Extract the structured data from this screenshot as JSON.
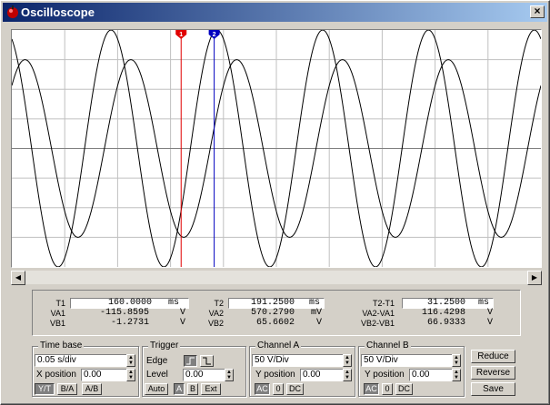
{
  "window": {
    "title": "Oscilloscope",
    "close_label": "×"
  },
  "chart_data": {
    "type": "line",
    "xlim": [
      0,
      0.5
    ],
    "ylim": [
      -200,
      200
    ],
    "grid": true,
    "series": [
      {
        "amplitude": 200,
        "phase_deg": 112.5,
        "freq_hz": 10
      },
      {
        "amplitude": 150,
        "phase_deg": 45,
        "freq_hz": 10
      }
    ],
    "cursors": [
      {
        "label": "1",
        "t": 0.16,
        "color": "#e00000"
      },
      {
        "label": "2",
        "t": 0.19125,
        "color": "#0000c0"
      }
    ]
  },
  "readout": {
    "t1_label": "T1",
    "t1": "160.0000",
    "t1_unit": "ms",
    "va1_label": "VA1",
    "va1": "-115.8595",
    "va1_unit": "V",
    "vb1_label": "VB1",
    "vb1": "-1.2731",
    "vb1_unit": "V",
    "t2_label": "T2",
    "t2": "191.2500",
    "t2_unit": "ms",
    "va2_label": "VA2",
    "va2": "570.2790",
    "va2_unit": "mV",
    "vb2_label": "VB2",
    "vb2": "65.6602",
    "vb2_unit": "V",
    "dt_label": "T2-T1",
    "dt": "31.2500",
    "dt_unit": "ms",
    "dva_label": "VA2-VA1",
    "dva": "116.4298",
    "dva_unit": "V",
    "dvb_label": "VB2-VB1",
    "dvb": "66.9333",
    "dvb_unit": "V"
  },
  "timebase": {
    "title": "Time base",
    "value": "0.05 s/div",
    "xpos_label": "X position",
    "xpos": "0.00",
    "modes": [
      "Y/T",
      "B/A",
      "A/B"
    ]
  },
  "trigger": {
    "title": "Trigger",
    "edge_label": "Edge",
    "level_label": "Level",
    "level": "0.00",
    "modes": [
      "Auto",
      "A",
      "B",
      "Ext"
    ]
  },
  "channel_a": {
    "title": "Channel A",
    "value": "50 V/Div",
    "ypos_label": "Y position",
    "ypos": "0.00",
    "coupling": [
      "AC",
      "0",
      "DC"
    ]
  },
  "channel_b": {
    "title": "Channel B",
    "value": "50 V/Div",
    "ypos_label": "Y position",
    "ypos": "0.00",
    "coupling": [
      "AC",
      "0",
      "DC"
    ]
  },
  "actions": {
    "reduce": "Reduce",
    "reverse": "Reverse",
    "save": "Save"
  }
}
